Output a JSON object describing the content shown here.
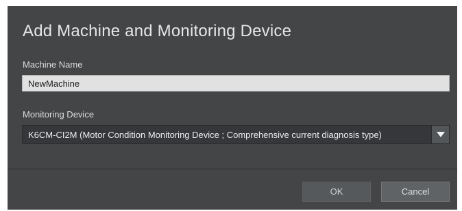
{
  "dialog": {
    "title": "Add Machine and Monitoring Device",
    "machine_name": {
      "label": "Machine Name",
      "value": "NewMachine"
    },
    "monitoring_device": {
      "label": "Monitoring Device",
      "selected": "K6CM-CI2M  (Motor Condition Monitoring Device ; Comprehensive current diagnosis type)",
      "dropdown_icon": "triangle-down-icon"
    },
    "buttons": {
      "ok_label": "OK",
      "cancel_label": "Cancel"
    }
  },
  "colors": {
    "dialog_background": "#434547",
    "input_background": "#e1e1e1",
    "select_background": "#35373a",
    "text": "#e6e6e6"
  }
}
